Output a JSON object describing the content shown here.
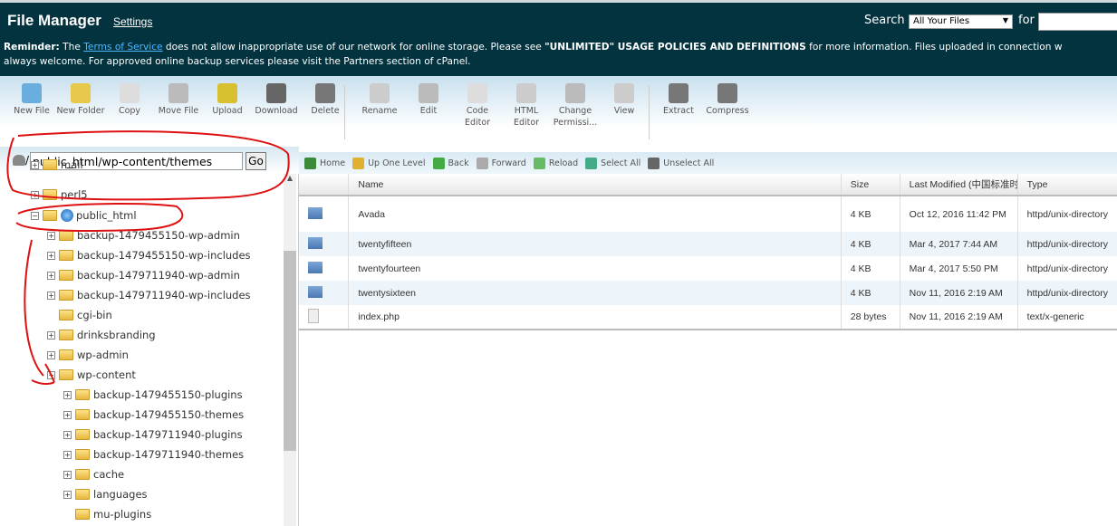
{
  "header": {
    "title": "File Manager",
    "settings": "Settings",
    "search_label": "Search",
    "search_scope": "All Your Files",
    "for_label": "for",
    "search_value": "",
    "reminder_label": "Reminder:",
    "reminder_pre": " The ",
    "tos_link": "Terms of Service",
    "reminder_mid": " does not allow inappropriate use of our network for online storage. Please see ",
    "policy": "\"UNLIMITED\" USAGE POLICIES AND DEFINITIONS",
    "reminder_post": " for more information. Files uploaded in connection w",
    "reminder_line2": "always welcome. For approved online backup services please visit the Partners section of cPanel."
  },
  "toolbar": [
    {
      "label": "New File",
      "icon": "new-file",
      "color": "#6aaee0"
    },
    {
      "label": "New Folder",
      "icon": "new-folder",
      "color": "#e8c84a"
    },
    {
      "label": "Copy",
      "icon": "copy",
      "color": "#ddd"
    },
    {
      "label": "Move File",
      "icon": "move-file",
      "color": "#bbb"
    },
    {
      "label": "Upload",
      "icon": "upload",
      "color": "#d8c030"
    },
    {
      "label": "Download",
      "icon": "download",
      "color": "#666"
    },
    {
      "label": "Delete",
      "icon": "delete",
      "color": "#777"
    },
    {
      "label": "Rename",
      "icon": "rename",
      "color": "#ccc"
    },
    {
      "label": "Edit",
      "icon": "edit",
      "color": "#bbb"
    },
    {
      "label": "Code Editor",
      "icon": "code-editor",
      "color": "#ddd"
    },
    {
      "label": "HTML Editor",
      "icon": "html-editor",
      "color": "#ccc"
    },
    {
      "label": "Change Permissi...",
      "icon": "key",
      "color": "#bbb"
    },
    {
      "label": "View",
      "icon": "magnifier",
      "color": "#ccc"
    },
    {
      "label": "Extract",
      "icon": "extract",
      "color": "#777"
    },
    {
      "label": "Compress",
      "icon": "compress",
      "color": "#777"
    }
  ],
  "path": {
    "value": "public_html/wp-content/themes",
    "go": "Go"
  },
  "tree": [
    {
      "label": "mail",
      "level": 1,
      "exp": "+"
    },
    {
      "label": "perl5",
      "level": 1,
      "exp": "+"
    },
    {
      "label": "public_html",
      "level": 1,
      "exp": "−"
    },
    {
      "label": "backup-1479455150-wp-admin",
      "level": 2,
      "exp": "+"
    },
    {
      "label": "backup-1479455150-wp-includes",
      "level": 2,
      "exp": "+"
    },
    {
      "label": "backup-1479711940-wp-admin",
      "level": 2,
      "exp": "+"
    },
    {
      "label": "backup-1479711940-wp-includes",
      "level": 2,
      "exp": "+"
    },
    {
      "label": "cgi-bin",
      "level": 2,
      "exp": ""
    },
    {
      "label": "drinksbranding",
      "level": 2,
      "exp": "+"
    },
    {
      "label": "wp-admin",
      "level": 2,
      "exp": "+"
    },
    {
      "label": "wp-content",
      "level": 2,
      "exp": "−"
    },
    {
      "label": "backup-1479455150-plugins",
      "level": 3,
      "exp": "+"
    },
    {
      "label": "backup-1479455150-themes",
      "level": 3,
      "exp": "+"
    },
    {
      "label": "backup-1479711940-plugins",
      "level": 3,
      "exp": "+"
    },
    {
      "label": "backup-1479711940-themes",
      "level": 3,
      "exp": "+"
    },
    {
      "label": "cache",
      "level": 3,
      "exp": "+"
    },
    {
      "label": "languages",
      "level": 3,
      "exp": "+"
    },
    {
      "label": "mu-plugins",
      "level": 3,
      "exp": ""
    }
  ],
  "nav": [
    {
      "label": "Home",
      "color": "#3a8a3a"
    },
    {
      "label": "Up One Level",
      "color": "#e0b030"
    },
    {
      "label": "Back",
      "color": "#4a4"
    },
    {
      "label": "Forward",
      "color": "#aaa"
    },
    {
      "label": "Reload",
      "color": "#6b6"
    },
    {
      "label": "Select All",
      "color": "#4a8"
    },
    {
      "label": "Unselect All",
      "color": "#666"
    }
  ],
  "table": {
    "headers": [
      "",
      "Name",
      "Size",
      "Last Modified (中国标准时",
      "Type"
    ],
    "rows": [
      {
        "kind": "folder",
        "name": "Avada",
        "size": "4 KB",
        "modified": "Oct 12, 2016 11:42 PM",
        "type": "httpd/unix-directory"
      },
      {
        "kind": "folder",
        "name": "twentyfifteen",
        "size": "4 KB",
        "modified": "Mar 4, 2017 7:44 AM",
        "type": "httpd/unix-directory"
      },
      {
        "kind": "folder",
        "name": "twentyfourteen",
        "size": "4 KB",
        "modified": "Mar 4, 2017 5:50 PM",
        "type": "httpd/unix-directory"
      },
      {
        "kind": "folder",
        "name": "twentysixteen",
        "size": "4 KB",
        "modified": "Nov 11, 2016 2:19 AM",
        "type": "httpd/unix-directory"
      },
      {
        "kind": "file",
        "name": "index.php",
        "size": "28 bytes",
        "modified": "Nov 11, 2016 2:19 AM",
        "type": "text/x-generic"
      }
    ]
  },
  "annotation_color": "#d11"
}
